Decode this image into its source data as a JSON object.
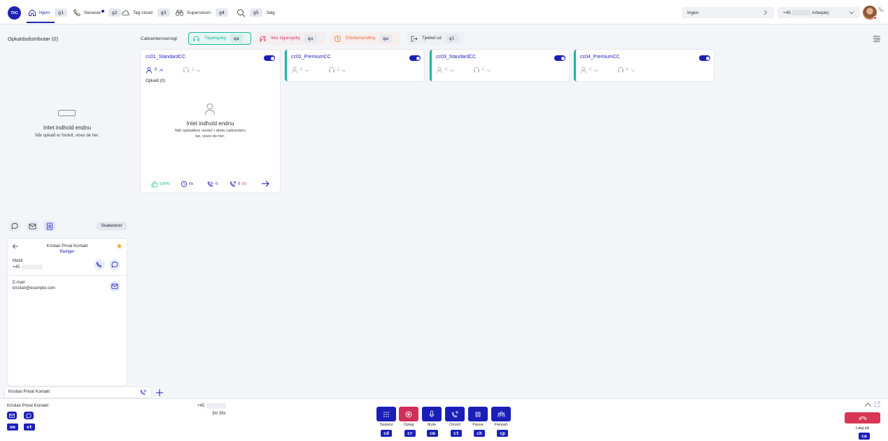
{
  "colors": {
    "primary": "#1b1fb8",
    "available": "#1fb6a0",
    "unavailable": "#d64368",
    "wrapup": "#ef6a3a",
    "hangup": "#d73654"
  },
  "topbar": {
    "logo": "TDC",
    "nav": [
      {
        "label": "Hjem",
        "shortcut": "g1",
        "icon": "home-icon"
      },
      {
        "label": "Seneste",
        "shortcut": "g2",
        "icon": "phone-icon"
      },
      {
        "label": "Tag cloud",
        "shortcut": "g3",
        "icon": "cloud-icon"
      },
      {
        "label": "Supervision",
        "shortcut": "g4",
        "icon": "binoculars-icon"
      },
      {
        "label": "Søg",
        "shortcut": "g5",
        "icon": "search-icon"
      }
    ],
    "status_select": "Ingen",
    "number_prefix": "+45",
    "number_suffix": "Arbejde)"
  },
  "distributor": {
    "title": "Opkaldsdistributør (0)",
    "empty_title": "Intet indhold endnu",
    "empty_text": "Når opkald er fordelt, vises de her."
  },
  "overview": {
    "label": "Callcenteroversigt",
    "filters": [
      {
        "label": "Tilgængelig",
        "shortcut": "qa"
      },
      {
        "label": "Ikke tilgængelig",
        "shortcut": "qu"
      },
      {
        "label": "Efterbehandling",
        "shortcut": "qw"
      },
      {
        "label": "Tjekket ud",
        "shortcut": "ql"
      }
    ],
    "cards": [
      {
        "name": "cc01_StandardCC",
        "agents": "0",
        "calls": "2",
        "queue": "Opkald (0)",
        "empty_title": "Intet indhold endnu",
        "empty_text": "Når opkaldere venter i dette callcenters kø, vises de her.",
        "stats": {
          "rate": "100%",
          "wait": "0s",
          "answered": "0",
          "missed": "0",
          "missed_extra": "(0)"
        }
      },
      {
        "name": "cc02_PremiumCC",
        "agents": "0",
        "calls": "1"
      },
      {
        "name": "cc03_StandardCC",
        "agents": "0",
        "calls": "0"
      },
      {
        "name": "cc04_PremiumCC",
        "agents": "0",
        "calls": "0"
      }
    ]
  },
  "contact_panel": {
    "templates_button": "Skabeloner",
    "name": "Kristian Privat Kontakt",
    "edit": "Rediger",
    "mobile_label": "Mobil",
    "mobile_prefix": "+45",
    "email_label": "E-mail",
    "email": "kristian@example.com"
  },
  "tab": {
    "label": "Kristian Privat Kontakt"
  },
  "call_bar": {
    "contact_name": "Kristian Privat Kontakt",
    "shortcuts": [
      "om",
      "ot"
    ],
    "number_prefix": "+45",
    "duration": "3m 35s",
    "buttons": [
      {
        "label": "Tastatur",
        "shortcut": "cd",
        "icon": "dialpad-icon"
      },
      {
        "label": "Optag",
        "shortcut": "cr",
        "icon": "record-icon"
      },
      {
        "label": "Mute",
        "shortcut": "cm",
        "icon": "microphone-icon"
      },
      {
        "label": "Omstil",
        "shortcut": "ct",
        "icon": "transfer-icon"
      },
      {
        "label": "Pause",
        "shortcut": "ch",
        "icon": "pause-icon"
      },
      {
        "label": "Flerpart",
        "shortcut": "cp",
        "icon": "conference-icon"
      }
    ],
    "hangup_label": "Læg på",
    "hangup_shortcut": "ce"
  }
}
